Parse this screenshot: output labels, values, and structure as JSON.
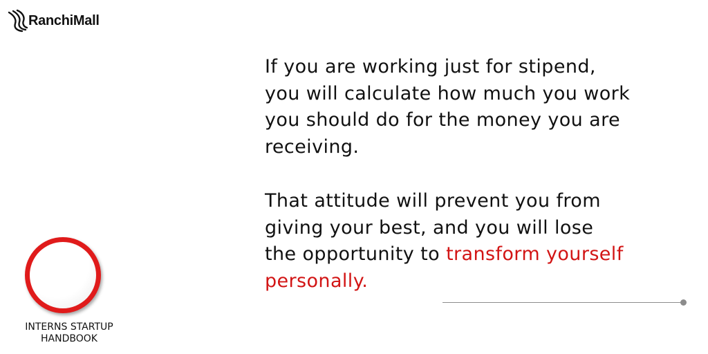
{
  "brand": {
    "name": "RanchiMall",
    "icon": "ranchimall-logo-icon"
  },
  "quote": {
    "paragraph1": [
      "If you are working just for stipend,",
      "you will calculate how much you work",
      "you should do for the money you are",
      "receiving."
    ],
    "paragraph2": [
      "That attitude will prevent you from",
      "giving your best, and you will lose"
    ],
    "paragraph2_line3_plain": "the opportunity to ",
    "paragraph2_line3_highlight": "transform yourself",
    "paragraph2_line4_highlight": "personally."
  },
  "handbook": {
    "line1": "INTERNS STARTUP",
    "line2": "HANDBOOK"
  },
  "colors": {
    "accent": "#d21414",
    "badge": "#e01b1b",
    "text": "#111111",
    "divider": "#8c8c8c"
  }
}
